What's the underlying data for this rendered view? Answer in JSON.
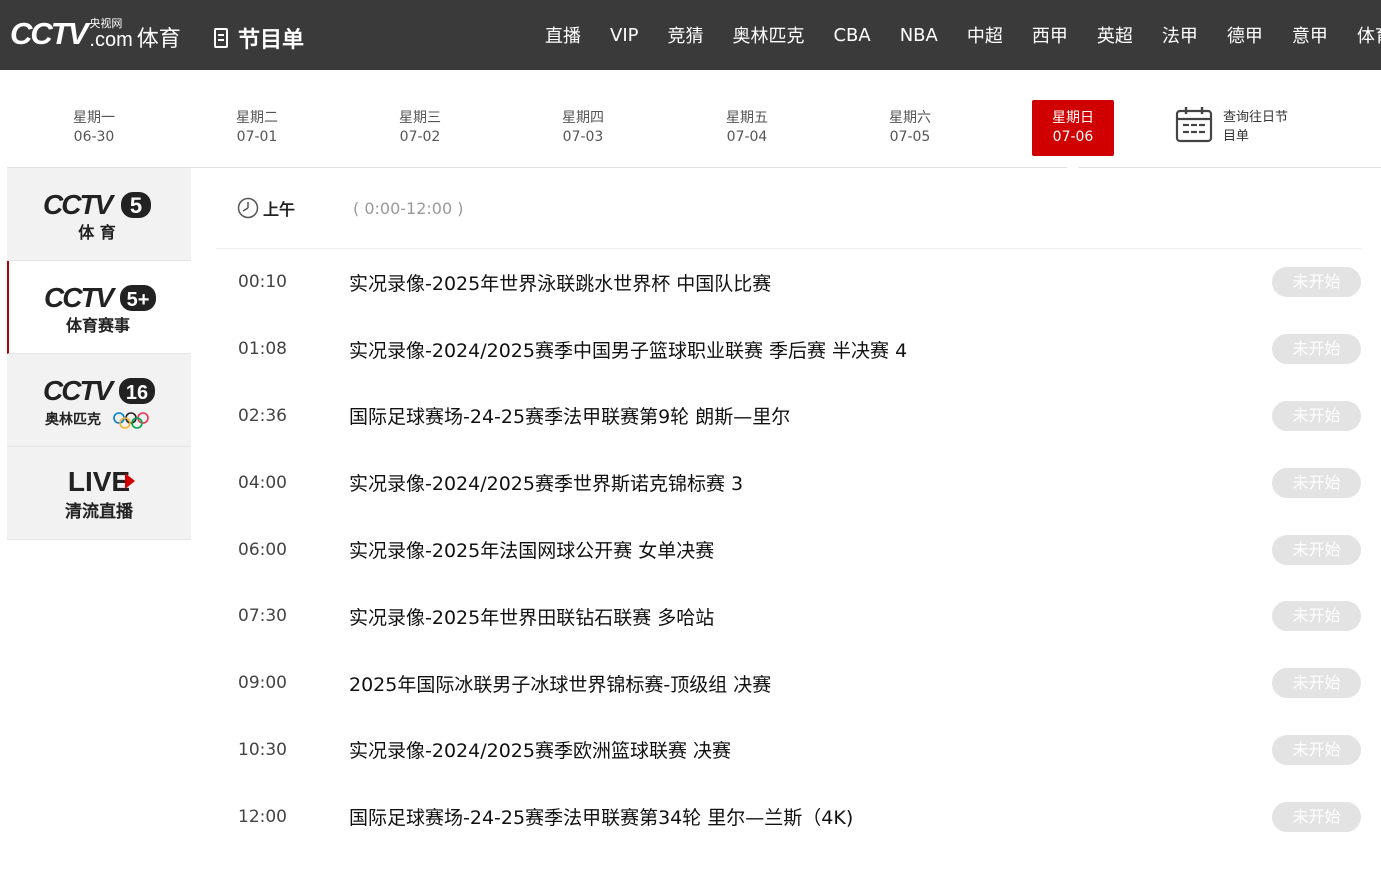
{
  "header": {
    "logo_cctv": "CCTV",
    "logo_wang": "央视网",
    "logo_com": ".com",
    "logo_sport": "体育",
    "page_title": "节目单",
    "nav": [
      "直播",
      "VIP",
      "竞猜",
      "奥林匹克",
      "CBA",
      "NBA",
      "中超",
      "西甲",
      "英超",
      "法甲",
      "德甲",
      "意甲",
      "体育地图"
    ]
  },
  "dates": [
    {
      "weekday": "星期一",
      "date": "06-30",
      "active": false
    },
    {
      "weekday": "星期二",
      "date": "07-01",
      "active": false
    },
    {
      "weekday": "星期三",
      "date": "07-02",
      "active": false
    },
    {
      "weekday": "星期四",
      "date": "07-03",
      "active": false
    },
    {
      "weekday": "星期五",
      "date": "07-04",
      "active": false
    },
    {
      "weekday": "星期六",
      "date": "07-05",
      "active": false
    },
    {
      "weekday": "星期日",
      "date": "07-06",
      "active": true
    }
  ],
  "history": {
    "label_line1": "查询往日节",
    "label_line2": "目单"
  },
  "channels": [
    {
      "logo_text": "CCTV",
      "number": "5",
      "subtitle": "体 育",
      "active": false
    },
    {
      "logo_text": "CCTV",
      "number": "5+",
      "subtitle": "体育赛事",
      "active": true
    },
    {
      "logo_text": "CCTV",
      "number": "16",
      "subtitle": "奥林匹克",
      "active": false
    },
    {
      "logo_text": "LIVE",
      "number": "",
      "subtitle": "清流直播",
      "active": false
    }
  ],
  "period": {
    "name": "上午",
    "range": "( 0:00-12:00 )"
  },
  "programs": [
    {
      "time": "00:10",
      "title": "实况录像-2025年世界泳联跳水世界杯 中国队比赛",
      "status": "未开始"
    },
    {
      "time": "01:08",
      "title": "实况录像-2024/2025赛季中国男子篮球职业联赛 季后赛 半决赛 4",
      "status": "未开始"
    },
    {
      "time": "02:36",
      "title": "国际足球赛场-24-25赛季法甲联赛第9轮 朗斯—里尔",
      "status": "未开始"
    },
    {
      "time": "04:00",
      "title": "实况录像-2024/2025赛季世界斯诺克锦标赛 3",
      "status": "未开始"
    },
    {
      "time": "06:00",
      "title": "实况录像-2025年法国网球公开赛 女单决赛",
      "status": "未开始"
    },
    {
      "time": "07:30",
      "title": "实况录像-2025年世界田联钻石联赛 多哈站",
      "status": "未开始"
    },
    {
      "time": "09:00",
      "title": "2025年国际冰联男子冰球世界锦标赛-顶级组 决赛",
      "status": "未开始"
    },
    {
      "time": "10:30",
      "title": "实况录像-2024/2025赛季欧洲篮球联赛 决赛",
      "status": "未开始"
    },
    {
      "time": "12:00",
      "title": "国际足球赛场-24-25赛季法甲联赛第34轮 里尔—兰斯（4K)",
      "status": "未开始"
    }
  ],
  "colors": {
    "topbar": "#3a3a3a",
    "accent": "#d10000",
    "status_pill": "#e3e3e3"
  }
}
